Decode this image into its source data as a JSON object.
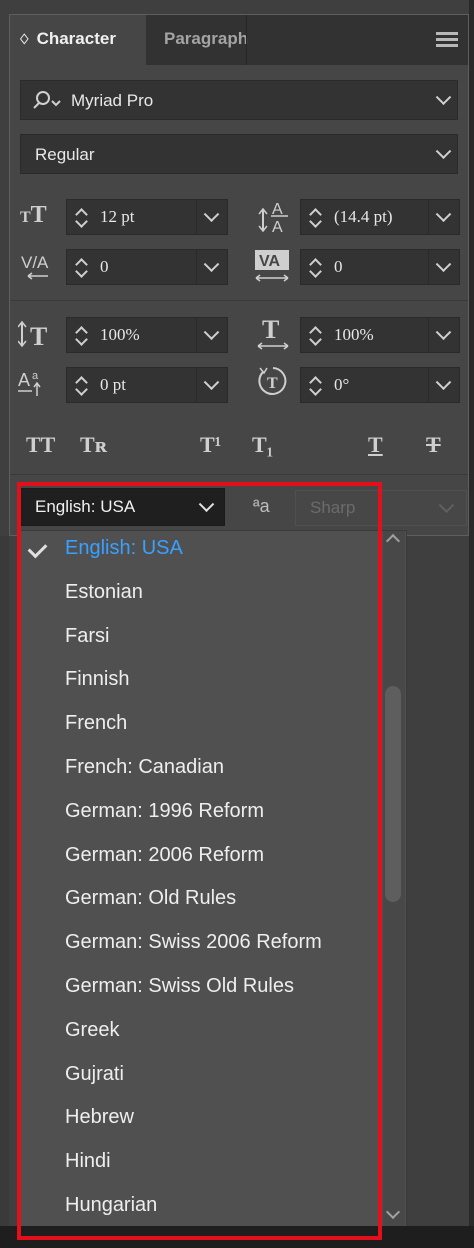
{
  "tabs": {
    "character": "Character",
    "paragraph": "Paragraph",
    "collapse_glyph": "♢"
  },
  "font": {
    "family": "Myriad Pro",
    "style": "Regular"
  },
  "fields": {
    "font_size": "12 pt",
    "leading": "(14.4 pt)",
    "kerning": "0",
    "tracking": "0",
    "vertical_scale": "100%",
    "horizontal_scale": "100%",
    "baseline_shift": "0 pt",
    "rotation": "0°"
  },
  "style_buttons": {
    "all_caps": "TT",
    "small_caps": "Tʀ",
    "superscript": "T¹",
    "subscript": "T₁",
    "underline": "T",
    "strikethrough": "T"
  },
  "language": {
    "selected": "English: USA",
    "antialias_icon": "ªa",
    "antialias": "Sharp"
  },
  "language_options": [
    "English: USA",
    "Estonian",
    "Farsi",
    "Finnish",
    "French",
    "French: Canadian",
    "German: 1996 Reform",
    "German: 2006 Reform",
    "German: Old Rules",
    "German: Swiss 2006 Reform",
    "German: Swiss Old Rules",
    "Greek",
    "Gujrati",
    "Hebrew",
    "Hindi",
    "Hungarian"
  ],
  "colors": {
    "accent": "#3aa0ff",
    "highlight": "#e3101c",
    "panel": "#464646"
  }
}
